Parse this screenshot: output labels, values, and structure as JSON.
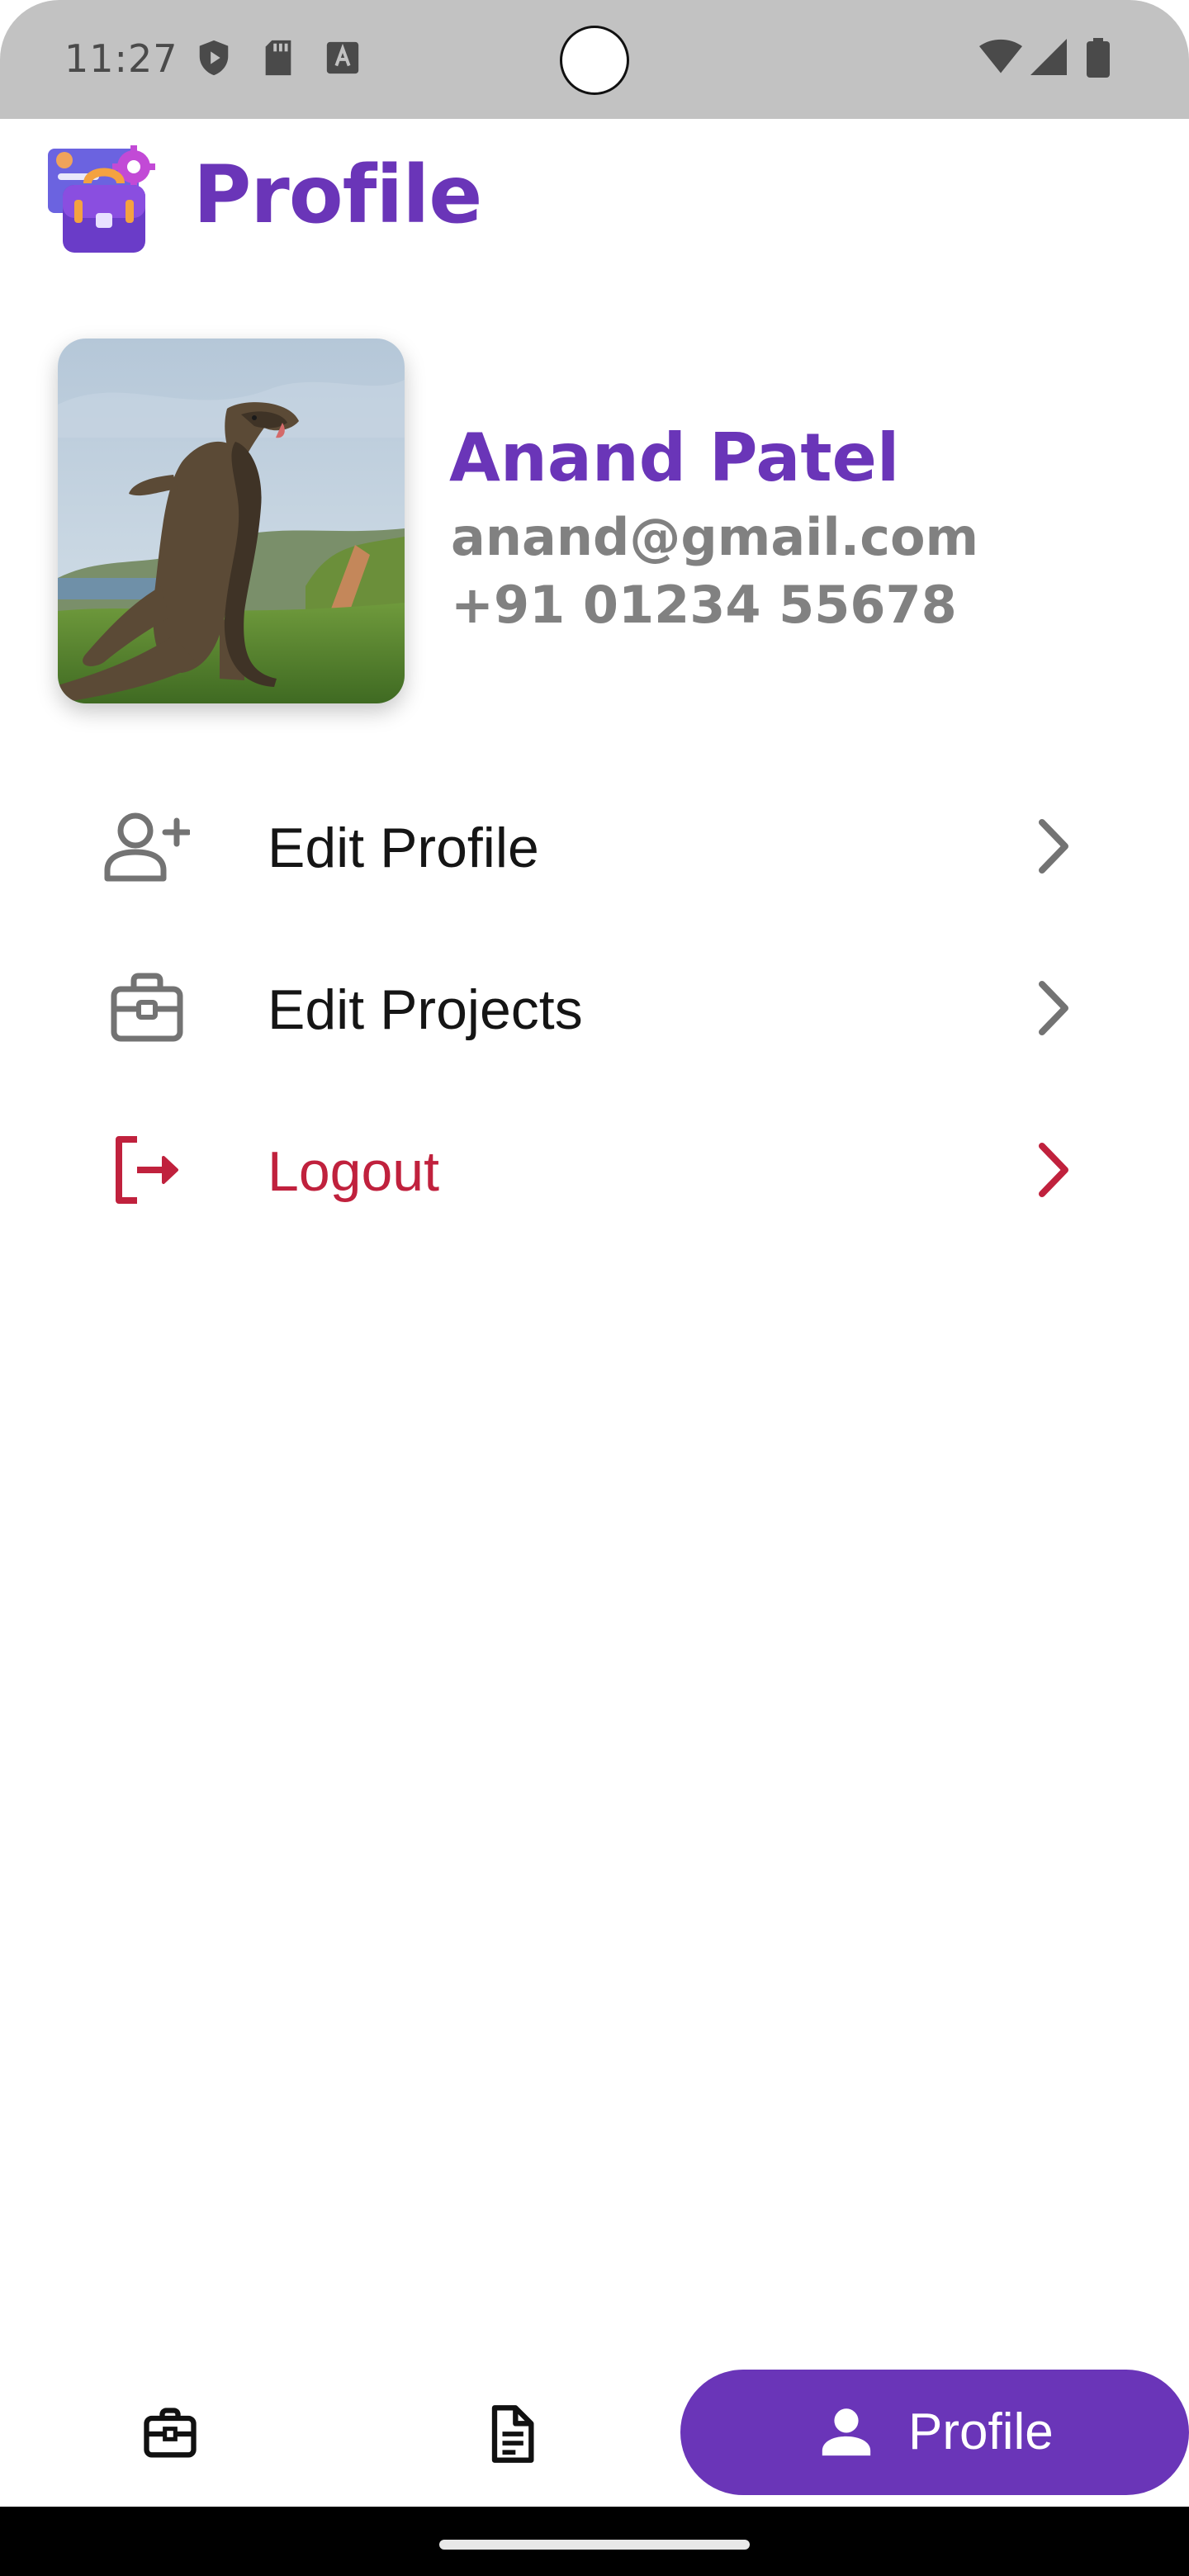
{
  "status_bar": {
    "time": "11:27",
    "left_icons": [
      "play-protect-icon",
      "sd-card-icon",
      "keyboard-a-icon"
    ],
    "right_icons": [
      "wifi-icon",
      "signal-icon",
      "battery-icon"
    ]
  },
  "header": {
    "title": "Profile",
    "logo_icon": "briefcase-gear-logo-icon"
  },
  "profile": {
    "name": "Anand Patel",
    "email": "anand@gmail.com",
    "phone": "+91 01234 55678"
  },
  "menu": {
    "items": [
      {
        "label": "Edit Profile",
        "icon": "add-user-icon",
        "style": "default"
      },
      {
        "label": "Edit Projects",
        "icon": "briefcase-icon",
        "style": "default"
      },
      {
        "label": "Logout",
        "icon": "logout-icon",
        "style": "danger"
      }
    ]
  },
  "bottom_nav": {
    "items": [
      {
        "icon": "briefcase-icon",
        "active": false
      },
      {
        "icon": "document-icon",
        "active": false
      },
      {
        "icon": "person-icon",
        "label": "Profile",
        "active": true
      }
    ]
  },
  "colors": {
    "accent": "#6a35b8",
    "secondary_text": "#818181",
    "danger": "#c0213d",
    "status_bar": "#c2c2c2"
  }
}
